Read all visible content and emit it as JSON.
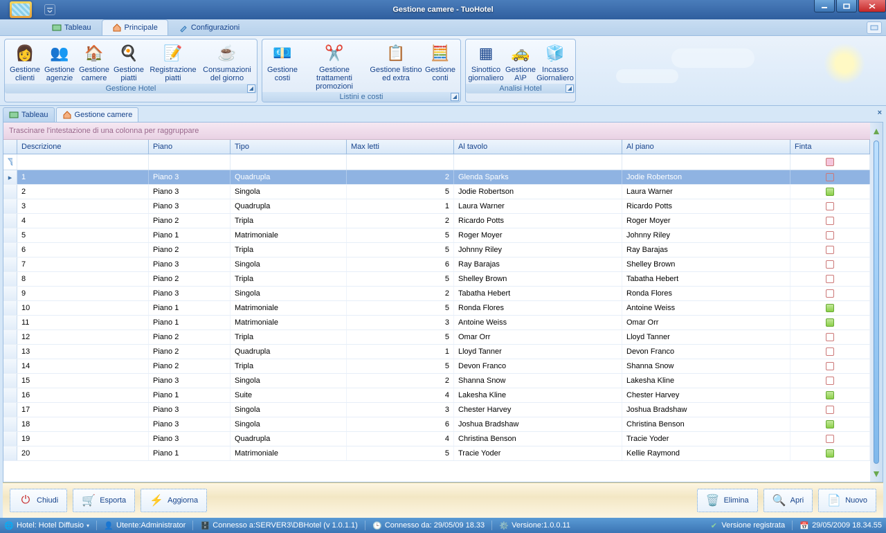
{
  "window": {
    "title": "Gestione camere - TuoHotel"
  },
  "ribbon_tabs": [
    {
      "label": "Tableau"
    },
    {
      "label": "Principale"
    },
    {
      "label": "Configurazioni"
    }
  ],
  "active_ribbon_tab": 1,
  "ribbon_groups": {
    "g1": {
      "title": "Gestione Hotel",
      "items": [
        "Gestione clienti",
        "Gestione agenzie",
        "Gestione camere",
        "Gestione piatti",
        "Registrazione piatti",
        "Consumazioni del giorno"
      ]
    },
    "g2": {
      "title": "Listini e costi",
      "items": [
        "Gestione costi",
        "Gestione trattamenti promozioni",
        "Gestione listino ed extra",
        "Gestione conti"
      ]
    },
    "g3": {
      "title": "Analisi Hotel",
      "items": [
        "Sinottico giornaliero",
        "Gestione A\\P",
        "Incasso Giornaliero"
      ]
    }
  },
  "subtabs": [
    {
      "label": "Tableau"
    },
    {
      "label": "Gestione camere"
    }
  ],
  "grid": {
    "group_hint": "Trascinare l'intestazione di una colonna per raggruppare",
    "columns": [
      "Descrizione",
      "Piano",
      "Tipo",
      "Max letti",
      "Al tavolo",
      "Al piano",
      "Finta"
    ],
    "rows": [
      {
        "d": "1",
        "p": "Piano 3",
        "t": "Quadrupla",
        "m": 2,
        "tav": "Glenda Sparks",
        "pia": "Jodie Robertson",
        "f": false
      },
      {
        "d": "2",
        "p": "Piano 3",
        "t": "Singola",
        "m": 5,
        "tav": "Jodie Robertson",
        "pia": "Laura Warner",
        "f": true
      },
      {
        "d": "3",
        "p": "Piano 3",
        "t": "Quadrupla",
        "m": 1,
        "tav": "Laura Warner",
        "pia": "Ricardo Potts",
        "f": false
      },
      {
        "d": "4",
        "p": "Piano 2",
        "t": "Tripla",
        "m": 2,
        "tav": "Ricardo Potts",
        "pia": "Roger Moyer",
        "f": false
      },
      {
        "d": "5",
        "p": "Piano 1",
        "t": "Matrimoniale",
        "m": 5,
        "tav": "Roger Moyer",
        "pia": "Johnny Riley",
        "f": false
      },
      {
        "d": "6",
        "p": "Piano 2",
        "t": "Tripla",
        "m": 5,
        "tav": "Johnny Riley",
        "pia": "Ray Barajas",
        "f": false
      },
      {
        "d": "7",
        "p": "Piano 3",
        "t": "Singola",
        "m": 6,
        "tav": "Ray Barajas",
        "pia": "Shelley Brown",
        "f": false
      },
      {
        "d": "8",
        "p": "Piano 2",
        "t": "Tripla",
        "m": 5,
        "tav": "Shelley Brown",
        "pia": "Tabatha Hebert",
        "f": false
      },
      {
        "d": "9",
        "p": "Piano 3",
        "t": "Singola",
        "m": 2,
        "tav": "Tabatha Hebert",
        "pia": "Ronda Flores",
        "f": false
      },
      {
        "d": "10",
        "p": "Piano 1",
        "t": "Matrimoniale",
        "m": 5,
        "tav": "Ronda Flores",
        "pia": "Antoine Weiss",
        "f": true
      },
      {
        "d": "11",
        "p": "Piano 1",
        "t": "Matrimoniale",
        "m": 3,
        "tav": "Antoine Weiss",
        "pia": "Omar Orr",
        "f": true
      },
      {
        "d": "12",
        "p": "Piano 2",
        "t": "Tripla",
        "m": 5,
        "tav": "Omar Orr",
        "pia": "Lloyd Tanner",
        "f": false
      },
      {
        "d": "13",
        "p": "Piano 2",
        "t": "Quadrupla",
        "m": 1,
        "tav": "Lloyd Tanner",
        "pia": "Devon Franco",
        "f": false
      },
      {
        "d": "14",
        "p": "Piano 2",
        "t": "Tripla",
        "m": 5,
        "tav": "Devon Franco",
        "pia": "Shanna Snow",
        "f": false
      },
      {
        "d": "15",
        "p": "Piano 3",
        "t": "Singola",
        "m": 2,
        "tav": "Shanna Snow",
        "pia": "Lakesha Kline",
        "f": false
      },
      {
        "d": "16",
        "p": "Piano 1",
        "t": "Suite",
        "m": 4,
        "tav": "Lakesha Kline",
        "pia": "Chester Harvey",
        "f": true
      },
      {
        "d": "17",
        "p": "Piano 3",
        "t": "Singola",
        "m": 3,
        "tav": "Chester Harvey",
        "pia": "Joshua Bradshaw",
        "f": false
      },
      {
        "d": "18",
        "p": "Piano 3",
        "t": "Singola",
        "m": 6,
        "tav": "Joshua Bradshaw",
        "pia": "Christina Benson",
        "f": true
      },
      {
        "d": "19",
        "p": "Piano 3",
        "t": "Quadrupla",
        "m": 4,
        "tav": "Christina Benson",
        "pia": "Tracie Yoder",
        "f": false
      },
      {
        "d": "20",
        "p": "Piano 1",
        "t": "Matrimoniale",
        "m": 5,
        "tav": "Tracie Yoder",
        "pia": "Kellie Raymond",
        "f": true
      }
    ],
    "selected_row": 0
  },
  "buttons": {
    "chiudi": "Chiudi",
    "esporta": "Esporta",
    "aggiorna": "Aggiorna",
    "elimina": "Elimina",
    "apri": "Apri",
    "nuovo": "Nuovo"
  },
  "status": {
    "hotel": "Hotel: Hotel Diffusio",
    "utente": "Utente:Administrator",
    "conn": "Connesso a:SERVER3\\DBHotel (v 1.0.1.1)",
    "conn_da": "Connesso da: 29/05/09 18.33",
    "ver": "Versione:1.0.0.11",
    "reg": "Versione registrata",
    "clock": "29/05/2009 18.34.55"
  }
}
